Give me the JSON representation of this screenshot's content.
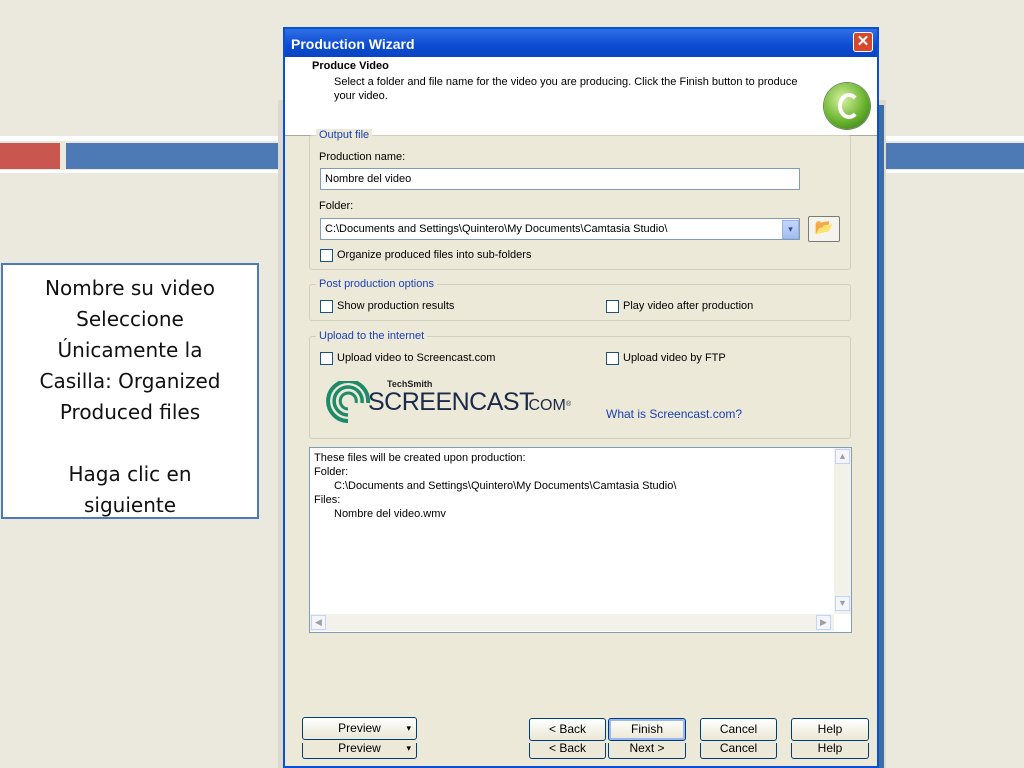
{
  "callout": {
    "line1": "Nombre su video",
    "line2": "Seleccione",
    "line3": "Únicamente la",
    "line4": "Casilla: Organized",
    "line5": "Produced files",
    "line6": "Haga clic en",
    "line7": "siguiente"
  },
  "dialog": {
    "title": "Production Wizard",
    "close_glyph": "✕",
    "header_title": "Produce Video",
    "header_desc": "Select a folder and file name for the video you are producing.  Click the Finish button to produce your video."
  },
  "output_file": {
    "legend": "Output file",
    "name_label": "Production name:",
    "name_value": "Nombre del video",
    "folder_label": "Folder:",
    "folder_value": "C:\\Documents and Settings\\Quintero\\My Documents\\Camtasia Studio\\",
    "browse_glyph": "📂",
    "organize_label": "Organize produced files into sub-folders"
  },
  "post_production": {
    "legend": "Post production options",
    "show_results_label": "Show production results",
    "play_video_label": "Play video after production"
  },
  "upload": {
    "legend": "Upload to the internet",
    "screencast_label": "Upload video to Screencast.com",
    "ftp_label": "Upload video by FTP",
    "logo_small": "TechSmith",
    "logo_big": "SCREENCAST",
    "logo_suffix": ".COM",
    "logo_tm": "®",
    "what_link": "What is Screencast.com?"
  },
  "info": {
    "line1": "These files will be created upon production:",
    "line2": "Folder:",
    "line3": "C:\\Documents and Settings\\Quintero\\My Documents\\Camtasia Studio\\",
    "line4": "Files:",
    "line5": "Nombre del video.wmv"
  },
  "buttons": {
    "preview": "Preview",
    "back": "< Back",
    "finish": "Finish",
    "next": "Next >",
    "cancel": "Cancel",
    "help": "Help",
    "dropdown_glyph": "▾"
  },
  "colors": {
    "accent_red": "#c95750",
    "accent_blue": "#4d7ab5",
    "xp_title_blue": "#0b4bd2",
    "link_blue": "#1a40b5"
  }
}
